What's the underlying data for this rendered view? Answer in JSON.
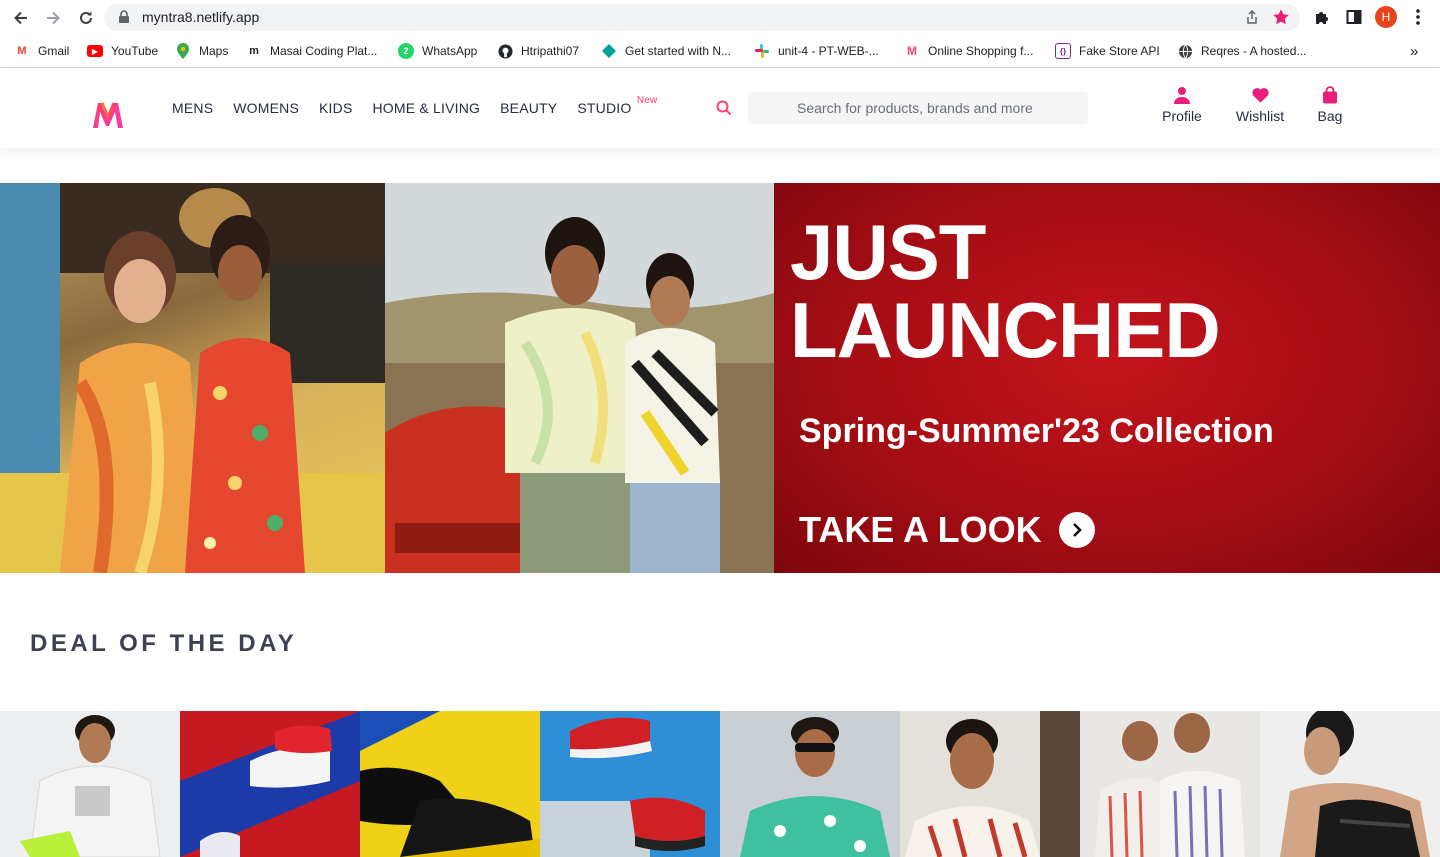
{
  "browser": {
    "url": "myntra8.netlify.app",
    "avatar_letter": "H",
    "bookmarks": [
      {
        "label": "Gmail",
        "icon": "gmail-icon"
      },
      {
        "label": "YouTube",
        "icon": "youtube-icon"
      },
      {
        "label": "Maps",
        "icon": "maps-icon"
      },
      {
        "label": "Masai Coding Plat...",
        "icon": "masai-icon"
      },
      {
        "label": "WhatsApp",
        "icon": "whatsapp-icon"
      },
      {
        "label": "Htripathi07",
        "icon": "github-icon"
      },
      {
        "label": "Get started with N...",
        "icon": "diamond-icon"
      },
      {
        "label": "unit-4 - PT-WEB-...",
        "icon": "slack-icon"
      },
      {
        "label": "Online Shopping f...",
        "icon": "myntra-icon"
      },
      {
        "label": "Fake Store API",
        "icon": "fakestore-icon"
      },
      {
        "label": "Reqres - A hosted...",
        "icon": "globe-icon"
      }
    ],
    "more_bookmarks": "»"
  },
  "header": {
    "nav": [
      "MENS",
      "WOMENS",
      "KIDS",
      "HOME & LIVING",
      "BEAUTY",
      "STUDIO"
    ],
    "new_badge": "New",
    "search_placeholder": "Search for products, brands and more",
    "profile": "Profile",
    "wishlist": "Wishlist",
    "bag": "Bag"
  },
  "banner": {
    "headline_line1": "JUST",
    "headline_line2": "LAUNCHED",
    "collection": "Spring-Summer'23 Collection",
    "cta": "TAKE A LOOK"
  },
  "deal": {
    "title": "DEAL OF THE DAY"
  },
  "colors": {
    "brand_pink": "#ff3f6c",
    "icon_pink": "#e91e78",
    "banner_red": "#b5101a",
    "heading_gray": "#3e4152"
  }
}
